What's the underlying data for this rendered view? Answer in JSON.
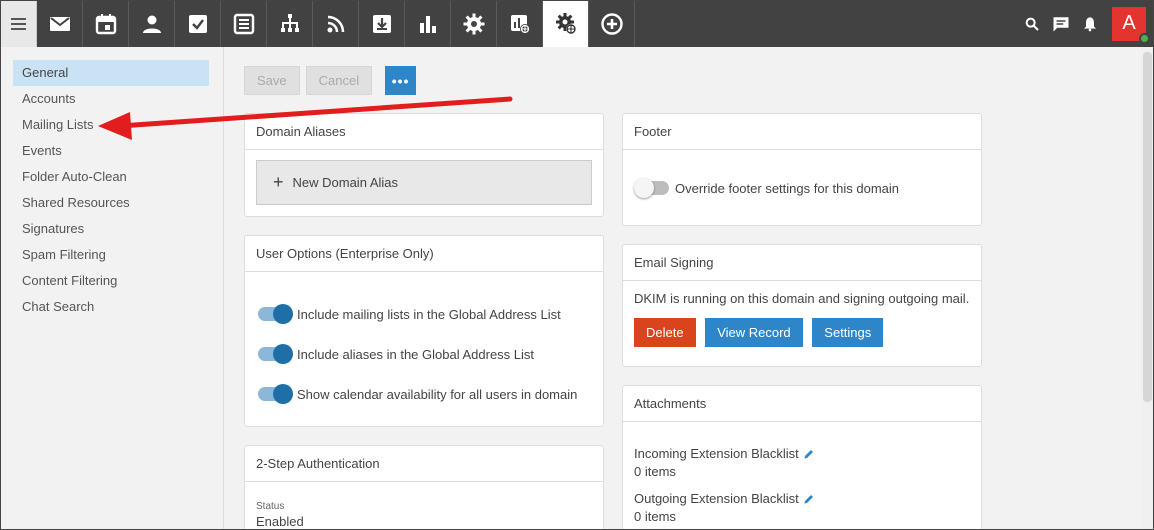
{
  "topbar": {
    "nav_icons": [
      "menu-icon",
      "mail-icon",
      "calendar-icon",
      "contacts-icon",
      "tasks-icon",
      "notes-icon",
      "sitemap-icon",
      "rss-icon",
      "download-icon",
      "reports-icon",
      "gear-icon",
      "domain-report-icon",
      "domain-settings-icon",
      "add-icon"
    ],
    "right_icons": [
      "search-icon",
      "chat-icon",
      "bell-icon"
    ],
    "avatar_letter": "A"
  },
  "sidebar": {
    "items": [
      {
        "label": "General",
        "active": true
      },
      {
        "label": "Accounts"
      },
      {
        "label": "Mailing Lists"
      },
      {
        "label": "Events"
      },
      {
        "label": "Folder Auto-Clean"
      },
      {
        "label": "Shared Resources"
      },
      {
        "label": "Signatures"
      },
      {
        "label": "Spam Filtering"
      },
      {
        "label": "Content Filtering"
      },
      {
        "label": "Chat Search"
      }
    ]
  },
  "toolbar": {
    "save": "Save",
    "cancel": "Cancel",
    "more": "•••"
  },
  "domain_aliases": {
    "title": "Domain Aliases",
    "new_alias": "New Domain Alias"
  },
  "user_options": {
    "title": "User Options (Enterprise Only)",
    "options": [
      "Include mailing lists in the Global Address List",
      "Include aliases in the Global Address List",
      "Show calendar availability for all users in domain"
    ]
  },
  "two_step": {
    "title": "2-Step Authentication",
    "status_label": "Status",
    "status_value": "Enabled"
  },
  "footer": {
    "title": "Footer",
    "override": "Override footer settings for this domain"
  },
  "email_signing": {
    "title": "Email Signing",
    "text": "DKIM is running on this domain and signing outgoing mail.",
    "delete": "Delete",
    "view_record": "View Record",
    "settings": "Settings"
  },
  "attachments": {
    "title": "Attachments",
    "incoming_label": "Incoming Extension Blacklist",
    "incoming_count": "0 items",
    "outgoing_label": "Outgoing Extension Blacklist",
    "outgoing_count": "0 items"
  },
  "colors": {
    "accent": "#2e86c8",
    "danger": "#d9441c",
    "topbar": "#424242",
    "arrow": "#e21d1d"
  }
}
